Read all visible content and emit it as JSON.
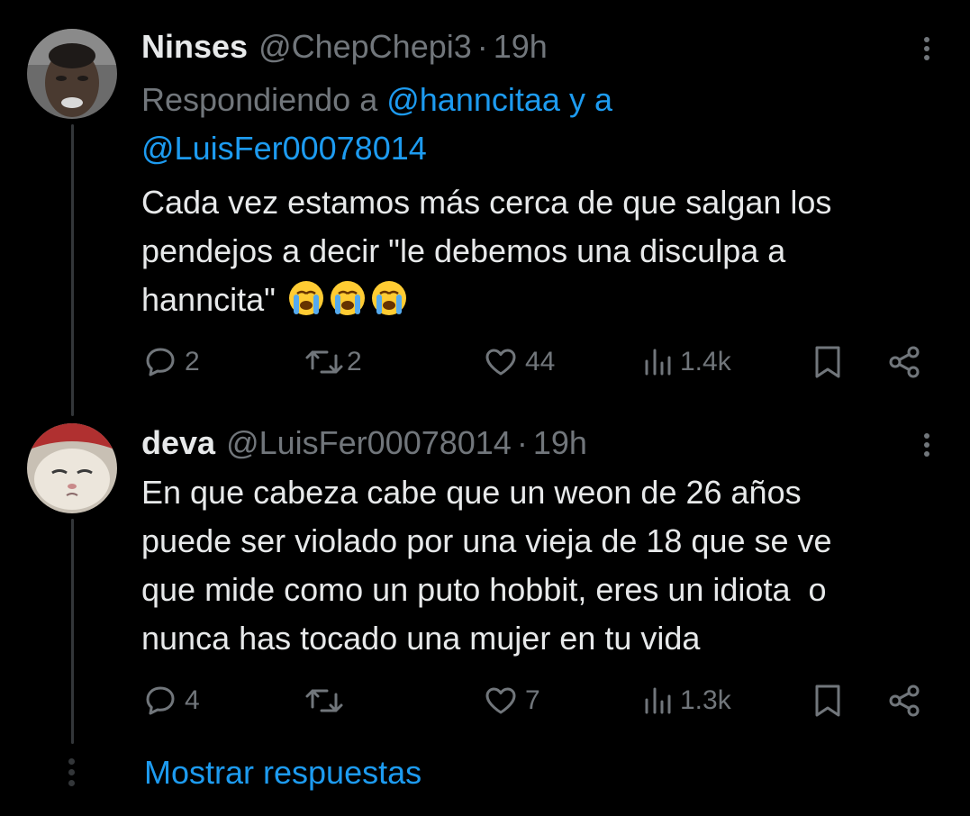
{
  "tweets": [
    {
      "name": "Ninses",
      "handle": "@ChepChepi3",
      "separator": "·",
      "time": "19h",
      "replying_prefix": "Respondiendo a",
      "replying_mention1": "@hanncitaa",
      "replying_and": "y a",
      "replying_mention2": "@LuisFer00078014",
      "text": "Cada vez estamos más cerca de que salgan los\npendejos a decir \"le debemos una disculpa a\nhanncita\"",
      "emoji": [
        "loudly-crying-face",
        "loudly-crying-face",
        "loudly-crying-face"
      ],
      "replies": "2",
      "retweets": "2",
      "likes": "44",
      "views": "1.4k"
    },
    {
      "name": "deva",
      "handle": "@LuisFer00078014",
      "separator": "·",
      "time": "19h",
      "text": "En que cabeza cabe que un weon de 26 años\npuede ser violado por una vieja de 18 que se ve\nque mide como un puto hobbit, eres un idiota  o\nnunca has tocado una mujer en tu vida",
      "replies": "4",
      "retweets": "",
      "likes": "7",
      "views": "1.3k"
    }
  ],
  "show_replies_label": "Mostrar respuestas",
  "colors": {
    "background": "#000000",
    "text": "#e7e9ea",
    "muted": "#71767b",
    "accent": "#1d9bf0",
    "line": "#333639"
  },
  "icons": [
    "reply-icon",
    "retweet-icon",
    "like-icon",
    "views-icon",
    "bookmark-icon",
    "share-icon",
    "more-icon"
  ]
}
